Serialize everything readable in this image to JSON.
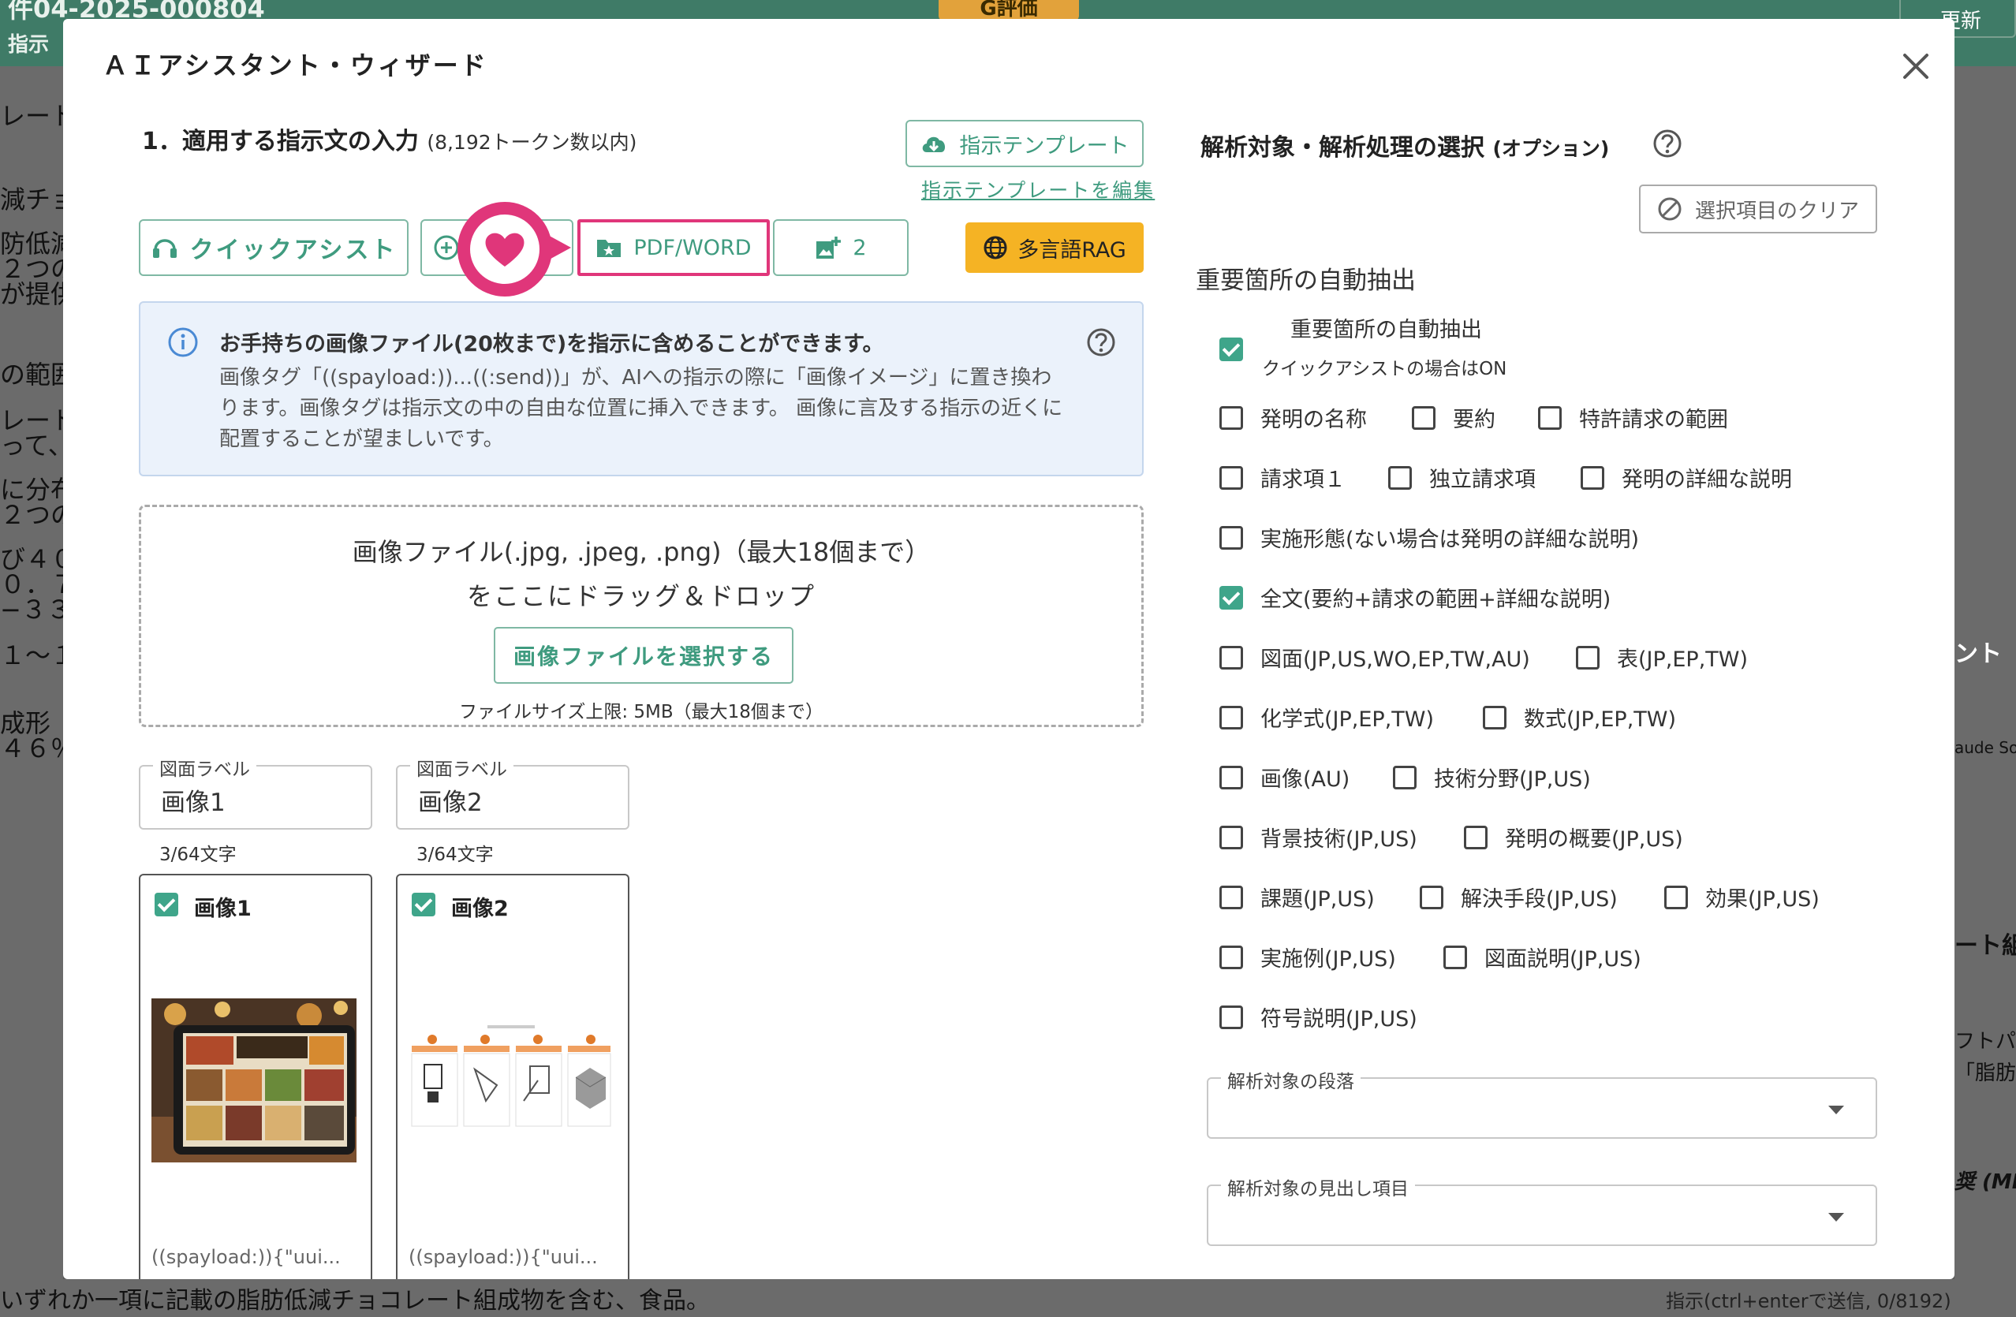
{
  "background": {
    "header_title": "件04-2025-000804",
    "header_nav": "指示",
    "eval_badge": "G評価",
    "update_button": "更新",
    "left_lines": [
      "レート",
      "減チョ",
      "防低減",
      "２つの",
      "が提供",
      "の範囲",
      "レート",
      "って、",
      "に分布",
      "２つの",
      "び４０",
      "０．７",
      "−３３",
      "１〜１",
      "成形",
      "４６％"
    ],
    "right_lines": [
      "ント",
      "aude Son",
      "ート組",
      "フトパ",
      "「脂肪",
      "奨 (MIN"
    ],
    "bottom_line": "いずれか一項に記載の脂肪低減チョコレート組成物を含む、食品。",
    "input_hint": "指示(ctrl+enterで送信, 0/8192)"
  },
  "modal": {
    "title": "ＡＩアシスタント・ウィザード"
  },
  "left": {
    "section_title": "1．適用する指示文の入力",
    "section_limit": "(8,192トークン数以内)",
    "template_button": "指示テンプレート",
    "template_edit_link": "指示テンプレートを編集",
    "quick_assist_button": "クイックアシスト",
    "pdf_word_button": "PDF/WORD",
    "image_count": "2",
    "multilang_rag_button": "多言語RAG",
    "info_title": "お手持ちの画像ファイル(20枚まで)を指示に含めることができます。",
    "info_body": "画像タグ「((spayload:))...((:send))」が、AIへの指示の際に「画像イメージ」に置き換わります。画像タグは指示文の中の自由な位置に挿入できます。 画像に言及する指示の近くに配置することが望ましいです。",
    "drop_line1": "画像ファイル(.jpg, .jpeg, .png)（最大18個まで）",
    "drop_line2": "をここにドラッグ＆ドロップ",
    "select_button": "画像ファイルを選択する",
    "drop_note": "ファイルサイズ上限: 5MB（最大18個まで）",
    "label_fields": [
      {
        "label": "図面ラベル",
        "value": "画像1",
        "counter": "3/64文字"
      },
      {
        "label": "図面ラベル",
        "value": "画像2",
        "counter": "3/64文字"
      }
    ],
    "cards": [
      {
        "title": "画像1",
        "checked": true,
        "tag": "((spayload:)){\"uui..."
      },
      {
        "title": "画像2",
        "checked": true,
        "tag": "((spayload:)){\"uui..."
      }
    ]
  },
  "right": {
    "title": "解析対象・解析処理の選択",
    "title_suffix": "(オプション)",
    "clear_button": "選択項目のクリア",
    "auto_section": "重要箇所の自動抽出",
    "auto_checkbox_label": "重要箇所の自動抽出",
    "auto_checkbox_sub": "クイックアシストの場合はON",
    "auto_checked": true,
    "options": {
      "invention_name": {
        "label": "発明の名称",
        "checked": false
      },
      "abstract": {
        "label": "要約",
        "checked": false
      },
      "claims": {
        "label": "特許請求の範囲",
        "checked": false
      },
      "claim1": {
        "label": "請求項１",
        "checked": false
      },
      "independent_claims": {
        "label": "独立請求項",
        "checked": false
      },
      "detailed_description": {
        "label": "発明の詳細な説明",
        "checked": false
      },
      "embodiment": {
        "label": "実施形態(ない場合は発明の詳細な説明)",
        "checked": false
      },
      "full_text": {
        "label": "全文(要約+請求の範囲+詳細な説明)",
        "checked": true
      },
      "drawings": {
        "label": "図面(JP,US,WO,EP,TW,AU)",
        "checked": false
      },
      "tables": {
        "label": "表(JP,EP,TW)",
        "checked": false
      },
      "chemical": {
        "label": "化学式(JP,EP,TW)",
        "checked": false
      },
      "math": {
        "label": "数式(JP,EP,TW)",
        "checked": false
      },
      "images": {
        "label": "画像(AU)",
        "checked": false
      },
      "tech_field": {
        "label": "技術分野(JP,US)",
        "checked": false
      },
      "background": {
        "label": "背景技術(JP,US)",
        "checked": false
      },
      "summary": {
        "label": "発明の概要(JP,US)",
        "checked": false
      },
      "problem": {
        "label": "課題(JP,US)",
        "checked": false
      },
      "solution": {
        "label": "解決手段(JP,US)",
        "checked": false
      },
      "effect": {
        "label": "効果(JP,US)",
        "checked": false
      },
      "examples": {
        "label": "実施例(JP,US)",
        "checked": false
      },
      "drawing_desc": {
        "label": "図面説明(JP,US)",
        "checked": false
      },
      "ref_signs": {
        "label": "符号説明(JP,US)",
        "checked": false
      }
    },
    "paragraph_select_label": "解析対象の段落",
    "heading_select_label": "解析対象の見出し項目"
  }
}
